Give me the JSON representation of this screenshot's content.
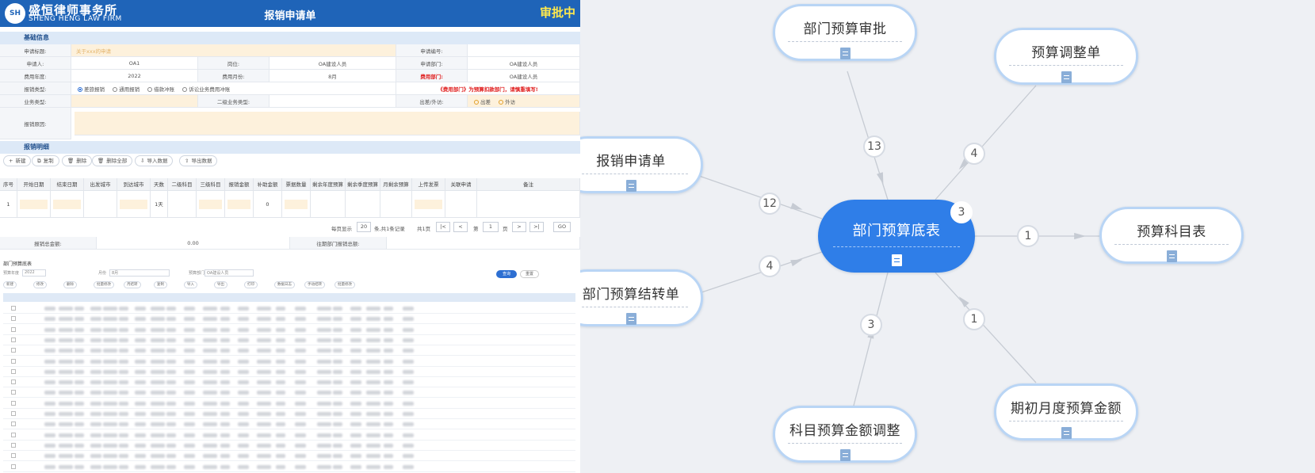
{
  "form": {
    "brand_cn": "盛恒律师事务所",
    "brand_en": "SHENG HENG LAW FIRM",
    "logo_text": "SH",
    "title": "报销申请单",
    "status": "审批中",
    "section_basic": "基础信息",
    "rows": {
      "apply_title_label": "申请标题:",
      "apply_title_value": "关于xxx的申请",
      "apply_no_label": "申请编号:",
      "applicant_label": "申请人:",
      "applicant_value": "OA1",
      "post_label": "岗位:",
      "post_value": "OA建设人员",
      "dept_label": "申请部门:",
      "dept_value": "OA建设人员",
      "year_label": "费用年度:",
      "year_value": "2022",
      "month_label": "费用月份:",
      "month_value": "8月",
      "cost_dept_label": "费用部门:",
      "cost_dept_value": "OA建设人员",
      "type_label": "报销类型:",
      "type_options": [
        "差旅报销",
        "通用报销",
        "借款冲账",
        "诉讼业务费用冲账"
      ],
      "type_note": "《费用部门》为预算扣款部门，请慎重填写!",
      "biz_type_label": "业务类型:",
      "biz_type2_label": "二级业务类型:",
      "trip_label": "出差/外访:",
      "trip_options": [
        "出差",
        "外访"
      ],
      "reason_label": "报销原因:"
    },
    "section_detail": "报销明细",
    "toolbar": [
      "新建",
      "复制",
      "删除",
      "删除全部",
      "导入数据",
      "导出数据"
    ],
    "grid_headers": [
      "序号",
      "开始日期",
      "结束日期",
      "出发城市",
      "到达城市",
      "天数",
      "二级科目",
      "三级科目",
      "报销金额",
      "补助金额",
      "票据数量",
      "剩余年度预算",
      "剩余季度预算",
      "月剩余预算",
      "上传发票",
      "关联申请",
      "备注"
    ],
    "grid_row": {
      "no": "1",
      "days": "1天",
      "subsidy": "0"
    },
    "pager": {
      "per_page_label": "每页显示",
      "per_page": "20",
      "rows_text": "条,共1条记录",
      "total_pages": "共1页",
      "page_label": "第",
      "page": "1",
      "page_suffix": "页",
      "go": "GO"
    },
    "sum_label": "报销总金额:",
    "sum_value": "0.00",
    "past_label": "往期部门报销总额:",
    "sum2_value": "0.00"
  },
  "inner": {
    "title": "部门预算底表",
    "filters": [
      "预算年度",
      "2022",
      "月份",
      "8月",
      "预算部门",
      "OA建设人员"
    ],
    "query": "查询",
    "reset": "重置",
    "buttons": [
      "新建",
      "修改",
      "删除",
      "批量修改",
      "月结转",
      "复制",
      "导入",
      "导出",
      "打印",
      "数据日志",
      "手动结转",
      "批量修改"
    ]
  },
  "mindmap": {
    "center": {
      "label": "部门预算底表",
      "count": "3"
    },
    "nodes": [
      {
        "id": "n1",
        "label": "部门预算审批",
        "edge": "13"
      },
      {
        "id": "n2",
        "label": "预算调整单",
        "edge": "4"
      },
      {
        "id": "n3",
        "label": "报销申请单",
        "edge": "12"
      },
      {
        "id": "n4",
        "label": "预算科目表",
        "edge": "1"
      },
      {
        "id": "n5",
        "label": "部门预算结转单",
        "edge": "4"
      },
      {
        "id": "n6",
        "label": "科目预算金额调整",
        "edge": "3"
      },
      {
        "id": "n7",
        "label": "期初月度预算金额",
        "edge": "1"
      }
    ],
    "colors": {
      "center": "#2f7ee8",
      "node_border": "#b9d5f5",
      "edge": "#c6cbd3",
      "doc_icon": "#8aaed8"
    }
  }
}
